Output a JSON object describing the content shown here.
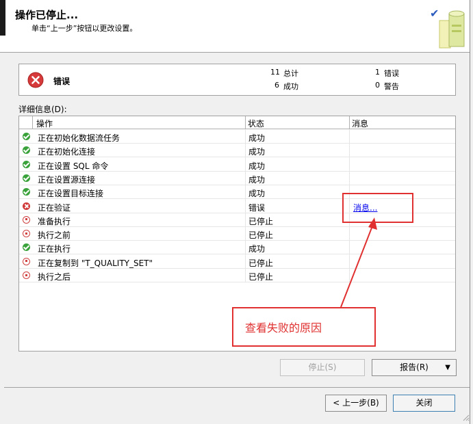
{
  "header": {
    "title": "操作已停止...",
    "subtitle": "单击“上一步”按钮以更改设置。"
  },
  "summary": {
    "status": "错误",
    "total_count": "11",
    "total_label": "总计",
    "success_count": "6",
    "success_label": "成功",
    "error_count": "1",
    "error_label": "错误",
    "warning_count": "0",
    "warning_label": "警告"
  },
  "details_label": "详细信息(D):",
  "grid": {
    "columns": [
      "操作",
      "状态",
      "消息"
    ],
    "rows": [
      {
        "icon": "success",
        "action": "正在初始化数据流任务",
        "state": "成功",
        "message": ""
      },
      {
        "icon": "success",
        "action": "正在初始化连接",
        "state": "成功",
        "message": ""
      },
      {
        "icon": "success",
        "action": "正在设置 SQL 命令",
        "state": "成功",
        "message": ""
      },
      {
        "icon": "success",
        "action": "正在设置源连接",
        "state": "成功",
        "message": ""
      },
      {
        "icon": "success",
        "action": "正在设置目标连接",
        "state": "成功",
        "message": ""
      },
      {
        "icon": "error",
        "action": "正在验证",
        "state": "错误",
        "message": "消息..."
      },
      {
        "icon": "stopped",
        "action": "准备执行",
        "state": "已停止",
        "message": ""
      },
      {
        "icon": "stopped",
        "action": "执行之前",
        "state": "已停止",
        "message": ""
      },
      {
        "icon": "success",
        "action": "正在执行",
        "state": "成功",
        "message": ""
      },
      {
        "icon": "stopped",
        "action": "正在复制到 \"T_QUALITY_SET\"",
        "state": "已停止",
        "message": ""
      },
      {
        "icon": "stopped",
        "action": "执行之后",
        "state": "已停止",
        "message": ""
      }
    ]
  },
  "annotation": {
    "text": "查看失败的原因"
  },
  "buttons": {
    "stop": "停止(S)",
    "report": "报告(R)",
    "back": "< 上一步(B)",
    "close": "关闭"
  },
  "colors": {
    "success": "#3aa23a",
    "error": "#d03a3a",
    "annotation": "#e03030",
    "link": "#0000ee"
  }
}
